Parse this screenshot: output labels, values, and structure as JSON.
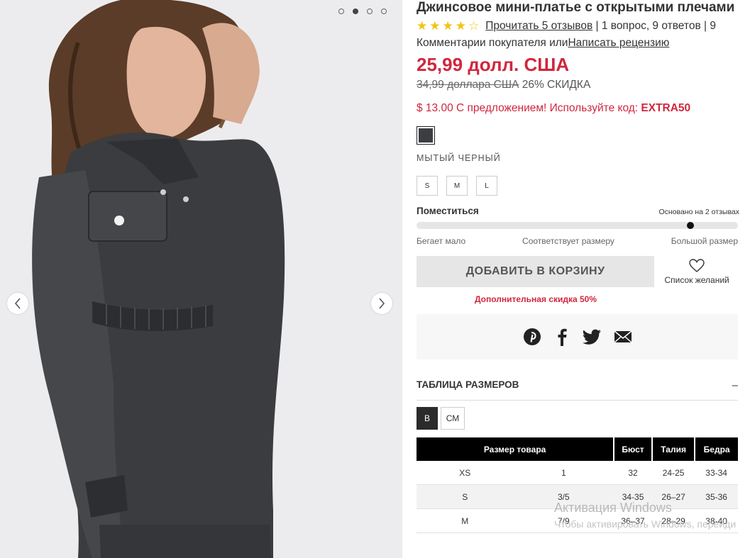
{
  "product": {
    "title": "Джинсовое мини-платье с открытыми плечами",
    "rating": 4,
    "reviews_link": "Прочитать 5 отзывов",
    "reviews_rest": " | 1 вопрос, 9 ответов | 9",
    "reviews_line2_a": "Комментарии покупателя или",
    "write_review": "Написать рецензию",
    "price": "25,99 долл. США",
    "old_price": "34,99 доллара США",
    "discount": " 26% СКИДКА",
    "promo_text": "$ 13.00 С предложением! Используйте код: ",
    "promo_code": "EXTRA50",
    "color_name": "МЫТЫЙ ЧЕРНЫЙ",
    "swatch_color": "#3c3d40",
    "sizes": [
      "S",
      "M",
      "L"
    ]
  },
  "fit": {
    "title": "Поместиться",
    "note": "Основано на 2 отзывах",
    "level": 0.86,
    "labels": [
      "Бегает мало",
      "Соответствует размеру",
      "Большой размер"
    ]
  },
  "actions": {
    "add_to_cart": "ДОБАВИТЬ В КОРЗИНУ",
    "wishlist": "Список желаний",
    "extra_discount": "Дополнительная скидка 50%"
  },
  "share": [
    "pinterest-icon",
    "facebook-icon",
    "twitter-icon",
    "email-icon"
  ],
  "size_chart": {
    "title": "ТАБЛИЦА РАЗМЕРОВ",
    "toggle": "–",
    "units": [
      "В",
      "СМ"
    ],
    "headers": [
      "Размер товара",
      "Бюст",
      "Талия",
      "Бедра"
    ],
    "rows": [
      [
        "XS",
        "1",
        "32",
        "24-25",
        "33-34"
      ],
      [
        "S",
        "3/5",
        "34-35",
        "26–27",
        "35-36"
      ],
      [
        "M",
        "7/9",
        "36–37",
        "28–29",
        "38-40"
      ]
    ]
  },
  "gallery": {
    "dots": 4,
    "active_dot": 1
  },
  "watermark": {
    "line1": "Активация Windows",
    "line2": "Чтобы активировать Windows, перейди"
  },
  "colors": {
    "accent": "#d0273e",
    "star": "#f1c40f"
  }
}
